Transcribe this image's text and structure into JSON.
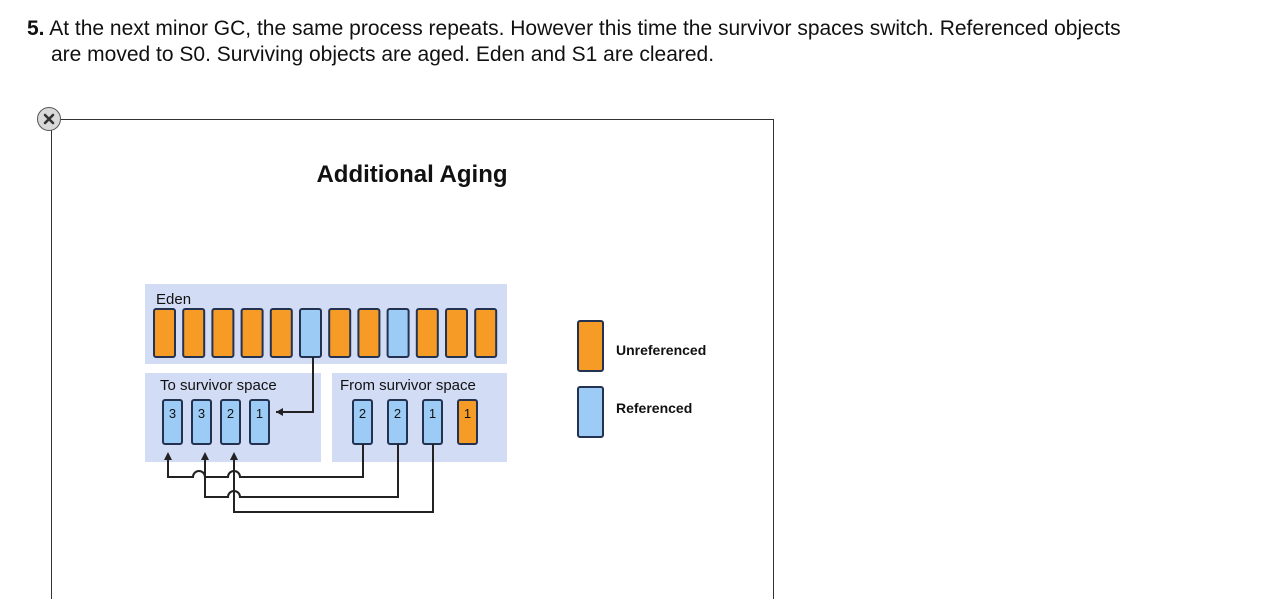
{
  "step": {
    "number": "5.",
    "line1": "At the next minor GC, the same process repeats. However this time the survivor spaces switch. Referenced objects",
    "line2": "are moved to S0. Surviving objects are aged. Eden and S1 are cleared."
  },
  "diagram": {
    "title": "Additional Aging",
    "eden_label": "Eden",
    "to_survivor_label": "To survivor space",
    "from_survivor_label": "From survivor space",
    "eden_cells": [
      "unref",
      "unref",
      "unref",
      "unref",
      "unref",
      "ref",
      "unref",
      "unref",
      "ref",
      "unref",
      "unref",
      "unref"
    ],
    "to_cells": [
      "3",
      "3",
      "2",
      "1"
    ],
    "from_cells": [
      {
        "age": "2",
        "state": "ref"
      },
      {
        "age": "2",
        "state": "ref"
      },
      {
        "age": "1",
        "state": "ref"
      },
      {
        "age": "1",
        "state": "unref"
      }
    ],
    "legend": {
      "unreferenced": "Unreferenced",
      "referenced": "Referenced"
    }
  },
  "colors": {
    "unreferenced": "#f59b26",
    "referenced": "#9ccbf5",
    "region_bg": "#d3dcf5",
    "cell_border": "#243252"
  }
}
